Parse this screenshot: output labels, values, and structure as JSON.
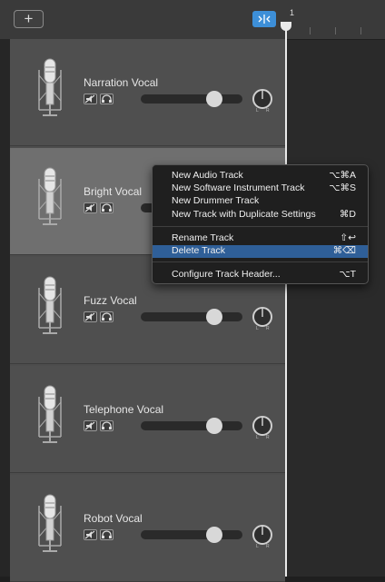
{
  "toolbar": {
    "add_label": "+"
  },
  "ruler": {
    "bar_number": "1"
  },
  "tracks": [
    {
      "name": "Narration Vocal",
      "volume": 0.72,
      "selected": false
    },
    {
      "name": "Bright Vocal",
      "volume": 0.72,
      "selected": true
    },
    {
      "name": "Fuzz Vocal",
      "volume": 0.72,
      "selected": false
    },
    {
      "name": "Telephone Vocal",
      "volume": 0.72,
      "selected": false
    },
    {
      "name": "Robot Vocal",
      "volume": 0.72,
      "selected": false
    }
  ],
  "pan_labels": {
    "left": "L",
    "right": "R"
  },
  "context_menu": {
    "items": [
      {
        "label": "New Audio Track",
        "shortcut": "⌥⌘A"
      },
      {
        "label": "New Software Instrument Track",
        "shortcut": "⌥⌘S"
      },
      {
        "label": "New Drummer Track",
        "shortcut": ""
      },
      {
        "label": "New Track with Duplicate Settings",
        "shortcut": "⌘D"
      },
      {
        "label": "Rename Track",
        "shortcut": "⇧↩"
      },
      {
        "label": "Delete Track",
        "shortcut": "⌘⌫"
      },
      {
        "label": "Configure Track Header...",
        "shortcut": "⌥T"
      }
    ],
    "highlighted": "Delete Track"
  },
  "colors": {
    "accent": "#3d8fd8",
    "menu_highlight": "#2f5f98",
    "selected_track": "#6f6f6f"
  },
  "icons": {
    "add": "plus-icon",
    "smart_controls": "smart-controls-icon",
    "mute": "mute-speaker-icon",
    "headphones": "headphones-icon",
    "microphone": "microphone-icon",
    "pan": "pan-knob-icon"
  }
}
